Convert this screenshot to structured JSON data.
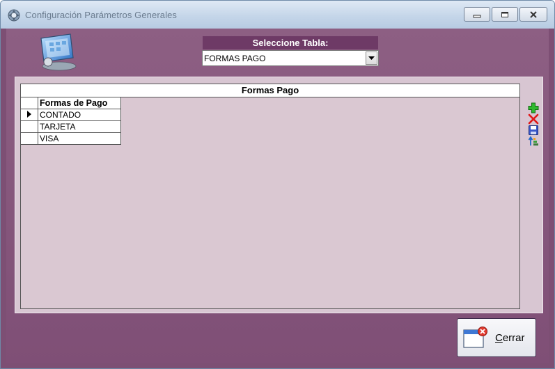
{
  "window": {
    "title": "Configuración Parámetros Generales",
    "min_icon": "minimize-icon",
    "max_icon": "maximize-icon",
    "close_icon": "close-icon"
  },
  "selector": {
    "label": "Seleccione Tabla:",
    "value": "FORMAS PAGO"
  },
  "grid": {
    "caption": "Formas Pago",
    "column_header": "Formas de Pago",
    "rows": [
      "CONTADO",
      "TARJETA",
      "VISA"
    ],
    "current_row": 0
  },
  "toolbar": {
    "icons": [
      "add-icon",
      "delete-icon",
      "save-icon",
      "sort-icon"
    ]
  },
  "close_button": {
    "label_first": "C",
    "label_rest": "errar"
  },
  "colors": {
    "client_bg": "#7f4f76",
    "label_bg": "#6e3a66",
    "panel_bg": "#d8c6d2"
  }
}
